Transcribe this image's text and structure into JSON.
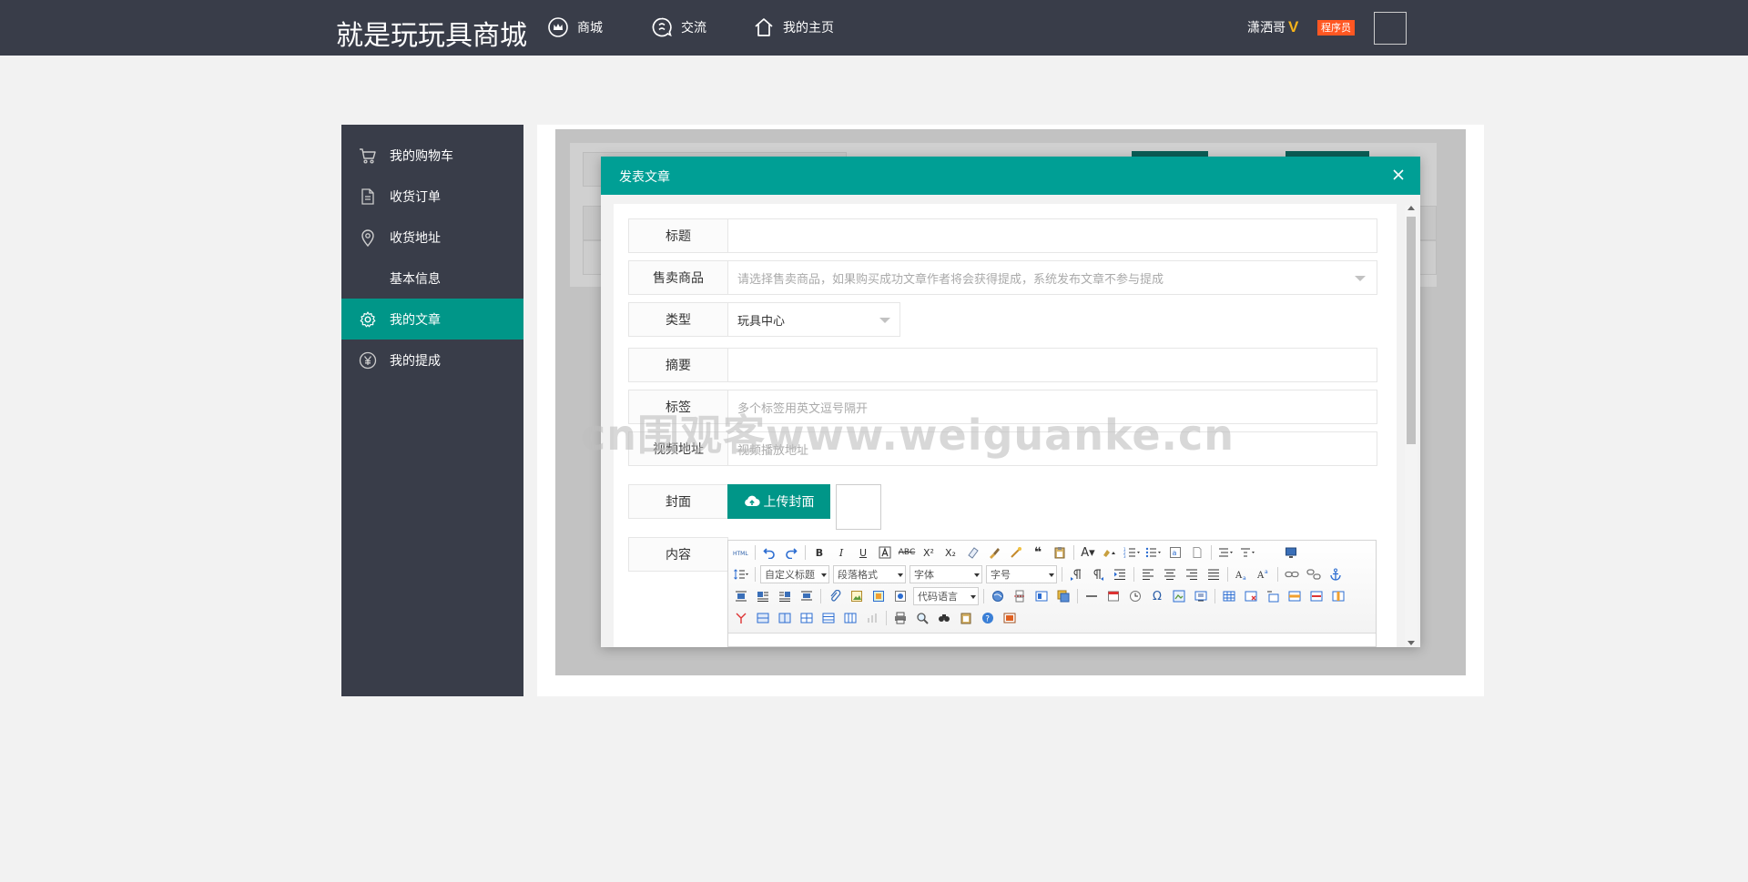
{
  "header": {
    "brand": "就是玩玩具商城",
    "nav": [
      {
        "label": "商城",
        "icon": "crown-icon"
      },
      {
        "label": "交流",
        "icon": "chat-icon"
      },
      {
        "label": "我的主页",
        "icon": "home-icon"
      }
    ],
    "username": "潇洒哥",
    "verified_mark": "V",
    "role": "程序员"
  },
  "sidebar": {
    "items": [
      {
        "label": "我的购物车",
        "icon": "cart-icon",
        "active": false
      },
      {
        "label": "收货订单",
        "icon": "document-icon",
        "active": false
      },
      {
        "label": "收货地址",
        "icon": "location-pin-icon",
        "active": false
      },
      {
        "label": "基本信息",
        "icon": "",
        "active": false
      },
      {
        "label": "我的文章",
        "icon": "gear-icon",
        "active": true
      },
      {
        "label": "我的提成",
        "icon": "yen-icon",
        "active": false
      }
    ]
  },
  "modal": {
    "title": "发表文章",
    "fields": {
      "title": {
        "label": "标题",
        "value": "",
        "placeholder": ""
      },
      "product": {
        "label": "售卖商品",
        "placeholder": "请选择售卖商品，如果购买成功文章作者将会获得提成，系统发布文章不参与提成"
      },
      "type": {
        "label": "类型",
        "value": "玩具中心"
      },
      "summary": {
        "label": "摘要",
        "value": "",
        "placeholder": ""
      },
      "tags": {
        "label": "标签",
        "placeholder": "多个标签用英文逗号隔开"
      },
      "video": {
        "label": "视频地址",
        "placeholder": "视频播放地址"
      },
      "cover": {
        "label": "封面",
        "button": "上传封面"
      },
      "content": {
        "label": "内容"
      }
    },
    "editor": {
      "custom_title": "自定义标题",
      "paragraph": "段落格式",
      "font": "字体",
      "font_size": "字号",
      "code_lang": "代码语言"
    }
  },
  "watermark": "cn围观客www.weiguanke.cn",
  "colors": {
    "header_bg": "#393d49",
    "accent": "#009688",
    "modal_head": "#009f95",
    "badge": "#ff5722",
    "verified": "#f5b31a"
  }
}
